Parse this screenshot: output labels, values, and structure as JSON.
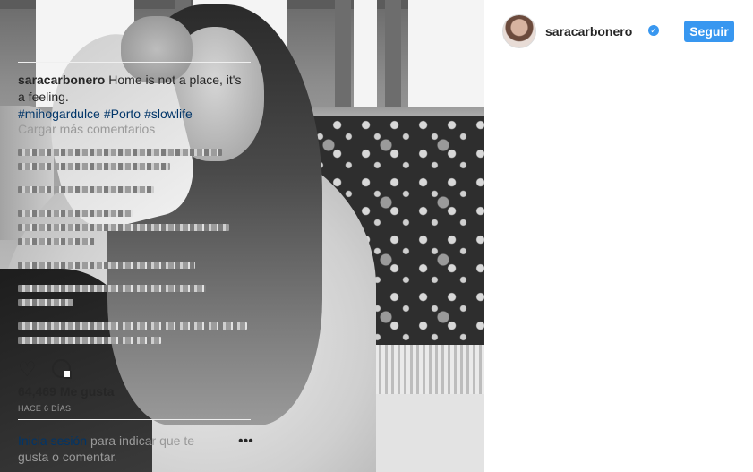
{
  "post": {
    "username": "saracarbonero",
    "follow_label": "Seguir",
    "caption_text": "Home is not a place, it's a feeling.",
    "hashtags": [
      "#mihogardulce",
      "#Porto",
      "#slowlife"
    ],
    "load_more_label": "Cargar más comentarios",
    "likes_count": "64,469",
    "likes_label": "Me gusta",
    "time_ago": "HACE 6 DÍAS",
    "login_link": "Inicia sesión",
    "login_text": "para indicar que te gusta o comentar.",
    "more_options": "•••"
  },
  "icons": {
    "verified": "verified-badge-icon",
    "like": "heart-icon",
    "comment": "comment-bubble-icon",
    "more": "more-options-icon"
  },
  "colors": {
    "accent_blue": "#3897f0",
    "link_blue": "#003569",
    "muted_gray": "#999999",
    "text": "#262626"
  }
}
